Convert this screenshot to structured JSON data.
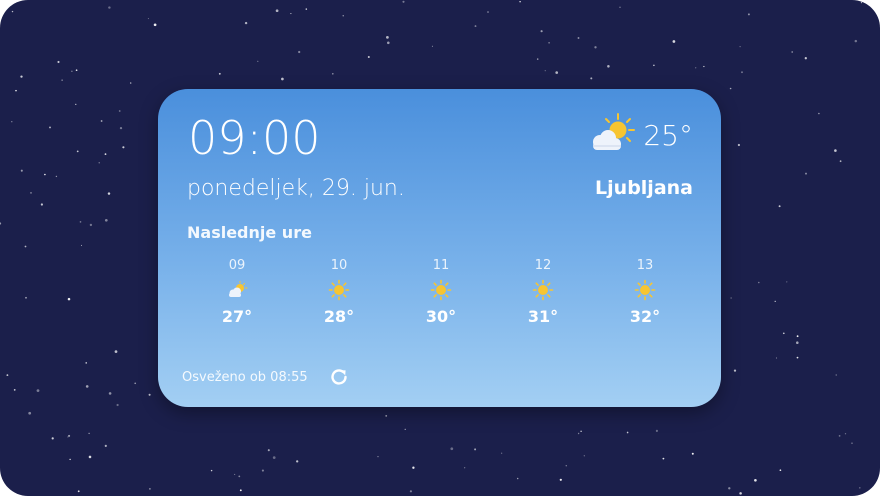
{
  "widget": {
    "time": "09:00",
    "date": "ponedeljek, 29. jun.",
    "current": {
      "icon": "partly-cloudy-icon",
      "temperature": "25°"
    },
    "city": "Ljubljana",
    "forecast_title": "Naslednje ure",
    "hours": [
      {
        "hour": "09",
        "icon": "partly-cloudy-icon",
        "temp": "27°"
      },
      {
        "hour": "10",
        "icon": "sun-icon",
        "temp": "28°"
      },
      {
        "hour": "11",
        "icon": "sun-icon",
        "temp": "30°"
      },
      {
        "hour": "12",
        "icon": "sun-icon",
        "temp": "31°"
      },
      {
        "hour": "13",
        "icon": "sun-icon",
        "temp": "32°"
      }
    ],
    "refreshed": "Osveženo ob 08:55",
    "refresh_icon": "refresh-icon"
  },
  "colors": {
    "background": "#1b1f4b",
    "widget_top": "#4a8fdc",
    "widget_bottom": "#a3cff3",
    "sun": "#f7c531"
  }
}
